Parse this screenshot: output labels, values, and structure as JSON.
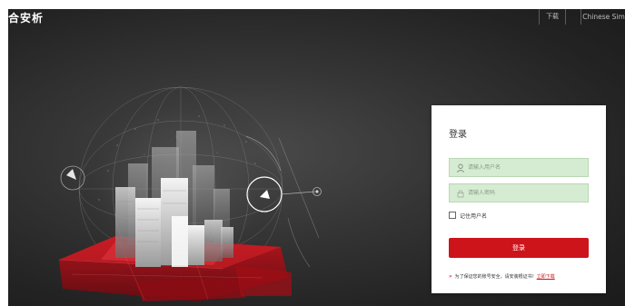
{
  "header": {
    "logo_text": "合安析",
    "download_label": "下载",
    "language_label": "Chinese Sim"
  },
  "login": {
    "title": "登录",
    "username_placeholder": "请输入用户名",
    "password_placeholder": "请输入密码",
    "remember_label": "记住用户名",
    "login_button": "登录",
    "notice_text": "为了保证您的账号安全，请安装根证书！",
    "notice_link": "立即下载"
  },
  "colors": {
    "accent_red": "#cc141a",
    "input_bg": "#d6ecd2",
    "background_dark": "#2b2b2b"
  },
  "icons": {
    "user_icon": "user-icon",
    "lock_icon": "lock-icon",
    "chevron_icon": "double-chevron-right-icon"
  }
}
